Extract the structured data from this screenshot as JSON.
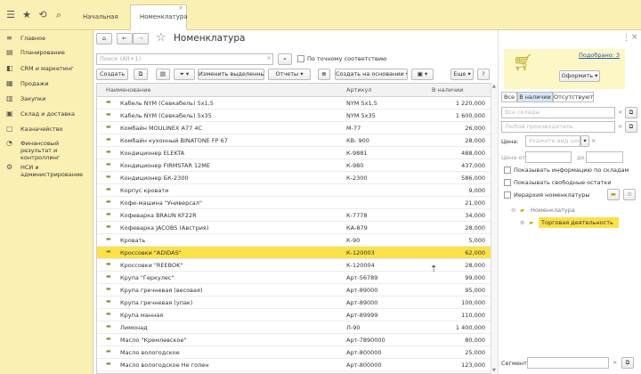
{
  "topbar": {
    "tabs": [
      {
        "label": "Начальная страница"
      },
      {
        "label": "Номенклатура"
      }
    ],
    "close_symbol": "×"
  },
  "sidebar": {
    "items": [
      {
        "label": "Главное",
        "icon": "menu-icon"
      },
      {
        "label": "Планирование",
        "icon": "chart-icon"
      },
      {
        "label": "CRM и маркетинг",
        "icon": "crm-icon"
      },
      {
        "label": "Продажи",
        "icon": "sales-icon"
      },
      {
        "label": "Закупки",
        "icon": "purchases-icon"
      },
      {
        "label": "Склад и доставка",
        "icon": "warehouse-icon"
      },
      {
        "label": "Казначейство",
        "icon": "treasury-icon"
      },
      {
        "label": "Финансовый результат и контроллинг",
        "icon": "finance-icon"
      },
      {
        "label": "НСИ и администрирование",
        "icon": "gear-icon"
      }
    ]
  },
  "form": {
    "title": "Номенклатура",
    "search_placeholder": "Поиск (Alt+1)",
    "exact_match_label": "По точному соответствию",
    "toolbar": {
      "create": "Создать",
      "change_selected": "Изменить выделенные",
      "reports": "Отчеты",
      "create_based_on": "Создать на основании",
      "more": "Еще",
      "help": "?"
    },
    "columns": [
      "Наименование",
      "Артикул",
      "В наличии"
    ],
    "rows": [
      {
        "name": "Кабель NYM (Севкабель) 5х1,5",
        "article": "NYM 5х1,5",
        "stock": "1 220,000"
      },
      {
        "name": "Кабель NYM (Севкабель) 5х35",
        "article": "NYM 5х35",
        "stock": "1 600,000"
      },
      {
        "name": "Комбайн MOULINEX  A77 4C",
        "article": "М-77",
        "stock": "26,000"
      },
      {
        "name": "Комбайн кухонный BINATONE FP 67",
        "article": "КВ- 900",
        "stock": "28,000"
      },
      {
        "name": "Кондиционер ELEKTA",
        "article": "К-9881",
        "stock": "488,000"
      },
      {
        "name": "Кондиционер FIRMSTAR 12МЕ",
        "article": "К-980",
        "stock": "437,000"
      },
      {
        "name": "Кондиционер БК-2300",
        "article": "К-2300",
        "stock": "586,000"
      },
      {
        "name": "Корпус кровати",
        "article": "",
        "stock": "9,000"
      },
      {
        "name": "Кофе-машина \"Универсал\"",
        "article": "",
        "stock": "21,000"
      },
      {
        "name": "Кофеварка BRAUN KF22R",
        "article": "К-7778",
        "stock": "34,000"
      },
      {
        "name": "Кофеварка JACOBS (Австрия)",
        "article": "КА-879",
        "stock": "28,000"
      },
      {
        "name": "Кровать",
        "article": "К-90",
        "stock": "5,000"
      },
      {
        "name": "Кроссовки \"ADIDAS\"",
        "article": "К-120003",
        "stock": "62,000"
      },
      {
        "name": "Кроссовки \"REEBOK\"",
        "article": "К-120004",
        "stock": "28,000"
      },
      {
        "name": "Крупа \"Геркулес\"",
        "article": "Арт-56789",
        "stock": "99,000"
      },
      {
        "name": "Крупа гречневая (весовая)",
        "article": "Арт-89000",
        "stock": "95,000"
      },
      {
        "name": "Крупа гречневая (упак)",
        "article": "Арт-89000",
        "stock": "100,000"
      },
      {
        "name": "Крупа манная",
        "article": "Арт-89999",
        "stock": "110,000"
      },
      {
        "name": "Лимонад",
        "article": "Л-90",
        "stock": "1 400,000"
      },
      {
        "name": "Масло \"Кремлевское\"",
        "article": "Арт-7890000",
        "stock": "80,000"
      },
      {
        "name": "Масло вологодское",
        "article": "Арт-800000",
        "stock": "25,000"
      },
      {
        "name": "Масло вологодское  Не голен",
        "article": "Арт-800000",
        "stock": "123,000"
      }
    ],
    "selected_row_index": 12
  },
  "right_panel": {
    "selected_link": "Подобрано: 3",
    "checkout_button": "Оформить",
    "segments": [
      "Все",
      "В наличии",
      "Отсутствуют"
    ],
    "active_segment": 1,
    "warehouses_placeholder": "Все склады",
    "manufacturer_placeholder": "Любой производитель",
    "price_label": "Цена:",
    "price_type_placeholder": "Укажите вид цены",
    "price_from_label": "Цена от:",
    "price_to_label": "до",
    "check_show_info": "Показывать информацию по складам",
    "check_show_free": "Показывать свободные остатки",
    "check_hierarchy": "Иерархия номенклатуры",
    "tree_root": "Номенклатура",
    "tree_child": "Торговая деятельность",
    "segment_label": "Сегмент:"
  },
  "colors": {
    "accent": "#fbe14a",
    "chrome": "#fbf0b4"
  }
}
